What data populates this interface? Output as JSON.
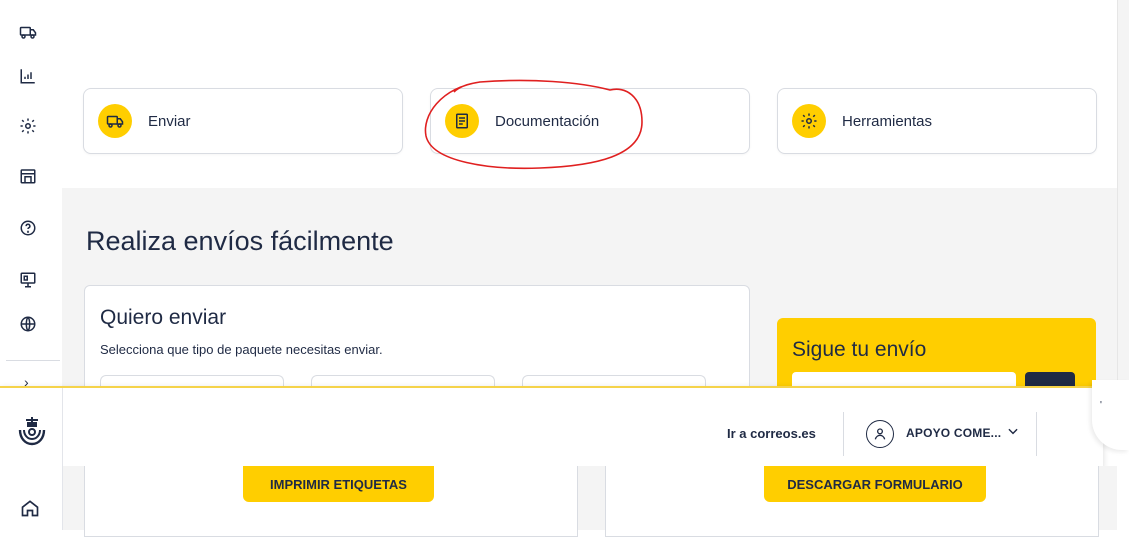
{
  "top_cards": [
    {
      "label": "Enviar",
      "icon": "truck-icon"
    },
    {
      "label": "Documentación",
      "icon": "document-icon"
    },
    {
      "label": "Herramientas",
      "icon": "gear-icon"
    }
  ],
  "main": {
    "title": "Realiza envíos fácilmente",
    "send_card": {
      "title": "Quiero enviar",
      "subtitle": "Selecciona que tipo de paquete necesitas enviar."
    },
    "track_card": {
      "title": "Sigue tu envío"
    }
  },
  "header": {
    "correos_link": "Ir a correos.es",
    "user_name": "APOYO COME..."
  },
  "bottom": {
    "print_button": "IMPRIMIR ETIQUETAS",
    "download_button": "DESCARGAR FORMULARIO"
  },
  "colors": {
    "accent": "#ffce00",
    "navy": "#1f2a44",
    "annotation": "#e02020"
  }
}
